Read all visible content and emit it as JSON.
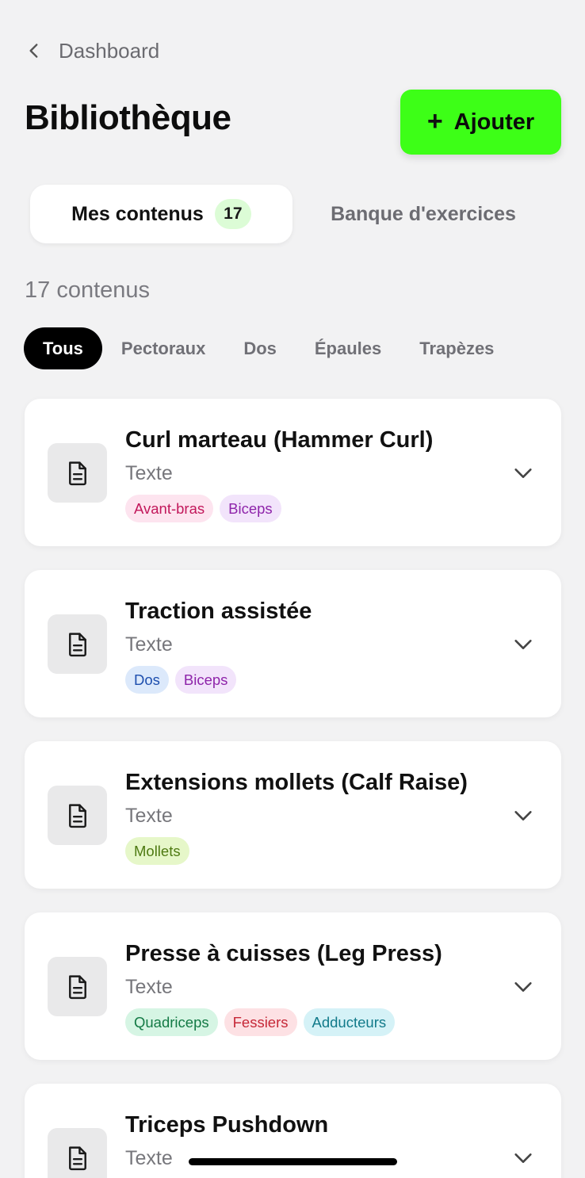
{
  "header": {
    "back_label": "Dashboard",
    "title": "Bibliothèque",
    "add_plus": "+",
    "add_label": "Ajouter"
  },
  "tabs": {
    "mine_label": "Mes contenus",
    "mine_count": "17",
    "bank_label": "Banque d'exercices"
  },
  "summary": "17 contenus",
  "filters": [
    "Tous",
    "Pectoraux",
    "Dos",
    "Épaules",
    "Trapèzes"
  ],
  "items": [
    {
      "name": "Curl marteau (Hammer Curl)",
      "type": "Texte",
      "icon": "document-icon",
      "tags": [
        {
          "label": "Avant-bras",
          "bg": "#fde4ef",
          "fg": "#c2185b"
        },
        {
          "label": "Biceps",
          "bg": "#f2e4fb",
          "fg": "#8e24aa"
        }
      ]
    },
    {
      "name": "Traction assistée",
      "type": "Texte",
      "icon": "document-icon",
      "tags": [
        {
          "label": "Dos",
          "bg": "#dce9fb",
          "fg": "#1e4fae"
        },
        {
          "label": "Biceps",
          "bg": "#f2e4fb",
          "fg": "#8e24aa"
        }
      ]
    },
    {
      "name": "Extensions mollets (Calf Raise)",
      "type": "Texte",
      "icon": "document-icon",
      "tags": [
        {
          "label": "Mollets",
          "bg": "#e6f7c9",
          "fg": "#4e7a12"
        }
      ]
    },
    {
      "name": "Presse à cuisses (Leg Press)",
      "type": "Texte",
      "icon": "document-icon",
      "tags": [
        {
          "label": "Quadriceps",
          "bg": "#d6f5e4",
          "fg": "#137a45"
        },
        {
          "label": "Fessiers",
          "bg": "#fde1e4",
          "fg": "#c62838"
        },
        {
          "label": "Adducteurs",
          "bg": "#d5f2f7",
          "fg": "#117a8a"
        }
      ]
    },
    {
      "name": "Triceps Pushdown",
      "type": "Texte",
      "icon": "document-icon",
      "tags": []
    }
  ],
  "colors": {
    "accent": "#3dff17",
    "background": "#f2f2f3",
    "active_chip": "#000000"
  }
}
